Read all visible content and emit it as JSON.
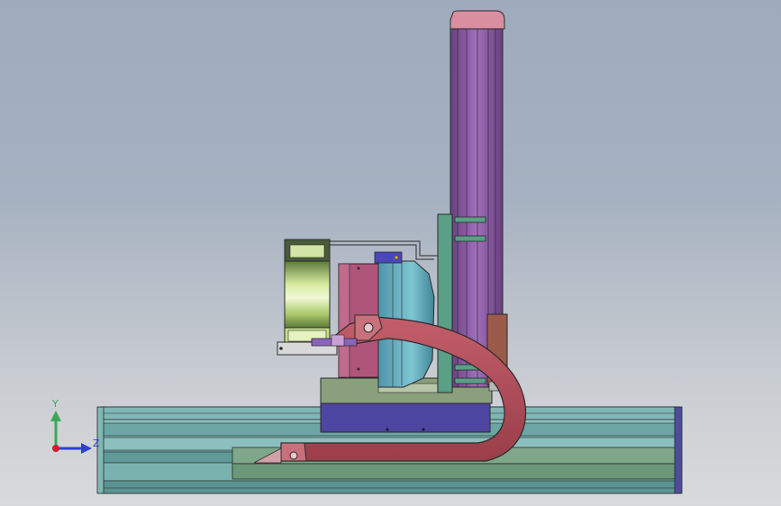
{
  "viewport": {
    "background_top": "#9eabbd",
    "background_bottom": "#d9dadb",
    "line_color": "#2a2a2a"
  },
  "model": {
    "colors": {
      "base_rail": "#6aa6a6",
      "base_rail_dark": "#4f8c8c",
      "base_rail_light": "#8fc1c0",
      "rail_end_cap": "#3c3a8c",
      "column": "#8f5aa8",
      "column_dark": "#6a3f80",
      "column_cap": "#d98fa0",
      "column_side_green": "#5aa086",
      "carriage_block": "#4c46a0",
      "mount_plate": "#8aa07c",
      "cable_chain": "#b24e5a",
      "cable_chain_dark": "#8c3440",
      "magenta_plate": "#b0557a",
      "motor_housing": "#6fb6c6",
      "motor_housing_dark": "#4f95a8",
      "gripper_body": "#c8e08c",
      "gripper_light": "#e6f2c0",
      "brown_block": "#9c5a4a",
      "blue_bracket": "#4a48b8"
    }
  },
  "triad": {
    "y_label": "Y",
    "z_label": "Z",
    "y_color": "#3aa858",
    "z_color": "#2f3fd0",
    "origin_color": "#d02030"
  }
}
